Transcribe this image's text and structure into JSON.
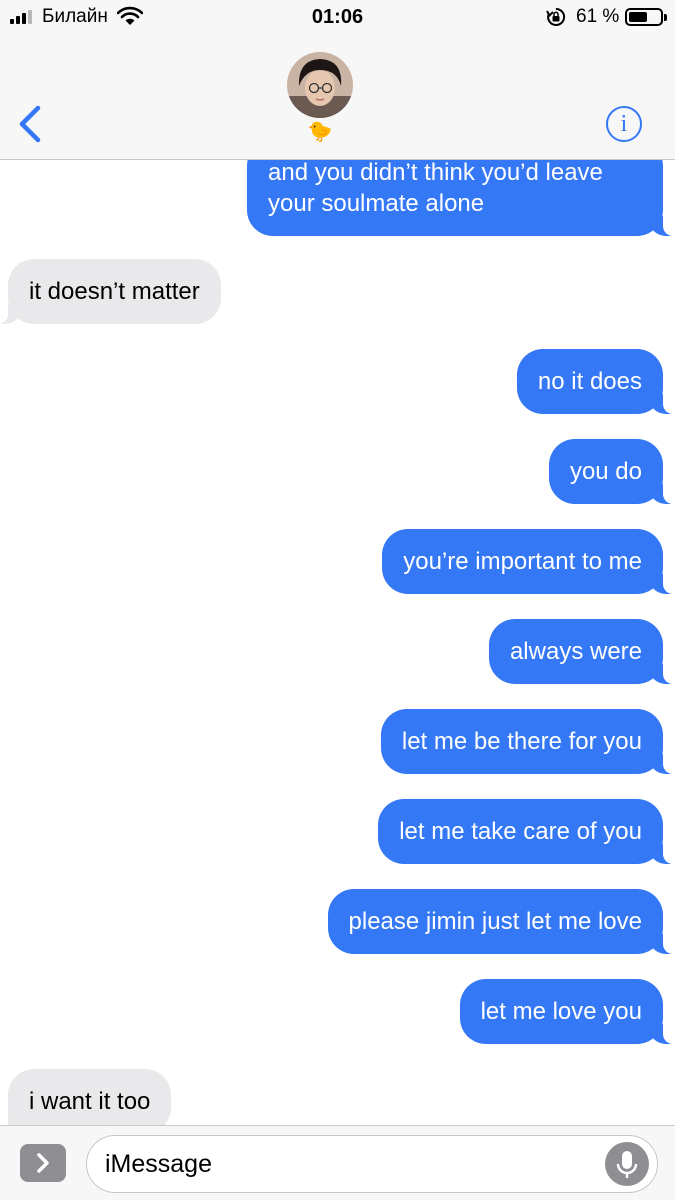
{
  "status_bar": {
    "carrier": "Билайн",
    "time": "01:06",
    "battery_percent": "61 %",
    "battery_level": 0.61
  },
  "header": {
    "contact_emoji": "🐤"
  },
  "composer": {
    "placeholder": "iMessage"
  },
  "messages": [
    {
      "from": "me",
      "text": "and you didn’t think you’d leave your soulmate alone"
    },
    {
      "from": "them",
      "text": "it doesn’t matter"
    },
    {
      "from": "me",
      "text": "no it does"
    },
    {
      "from": "me",
      "text": "you do"
    },
    {
      "from": "me",
      "text": "you’re important to me"
    },
    {
      "from": "me",
      "text": "always were"
    },
    {
      "from": "me",
      "text": "let me be there for you"
    },
    {
      "from": "me",
      "text": "let me take care of you"
    },
    {
      "from": "me",
      "text": "please jimin just let me love"
    },
    {
      "from": "me",
      "text": "let me love you"
    },
    {
      "from": "them",
      "text": "i want it too"
    }
  ],
  "icons": {
    "signal": "signal-bars-icon",
    "wifi": "wifi-icon",
    "rotation_lock": "rotation-lock-icon",
    "battery": "battery-icon",
    "back": "chevron-left-icon",
    "info": "info-icon",
    "apps": "chevron-right-icon",
    "mic": "microphone-icon"
  },
  "colors": {
    "sent_bubble": "#3478f6",
    "received_bubble": "#e9e9eb",
    "accent": "#3478f6"
  }
}
